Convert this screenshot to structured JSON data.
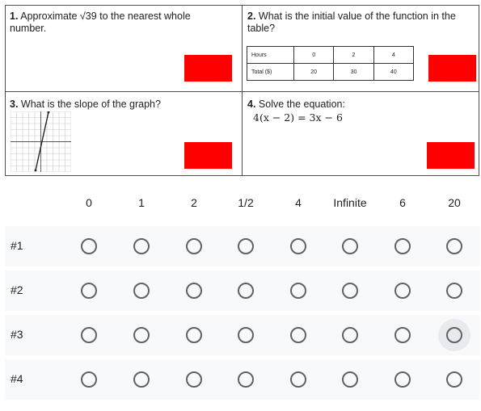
{
  "questions": {
    "q1": {
      "num": "1.",
      "text": "Approximate √39 to the nearest whole number."
    },
    "q2": {
      "num": "2.",
      "text": "What is the initial value of the function in the table?",
      "table": {
        "row1": [
          "Hours",
          "0",
          "2",
          "4"
        ],
        "row2": [
          "Total ($)",
          "20",
          "30",
          "40"
        ]
      }
    },
    "q3": {
      "num": "3.",
      "text": "What is the slope of the graph?"
    },
    "q4": {
      "num": "4.",
      "text": "Solve the equation:",
      "equation": "4(x − 2) = 3x − 6"
    }
  },
  "grid": {
    "columns": [
      "0",
      "1",
      "2",
      "1/2",
      "4",
      "Infinite",
      "6",
      "20"
    ],
    "rows": [
      "#1",
      "#2",
      "#3",
      "#4"
    ],
    "hover_row": 2,
    "hover_col": 7
  },
  "colors": {
    "answer_box": "#ff0000",
    "row_bg": "#f8f9fa",
    "radio_border": "#5f6368",
    "halo": "#e8eaed"
  }
}
